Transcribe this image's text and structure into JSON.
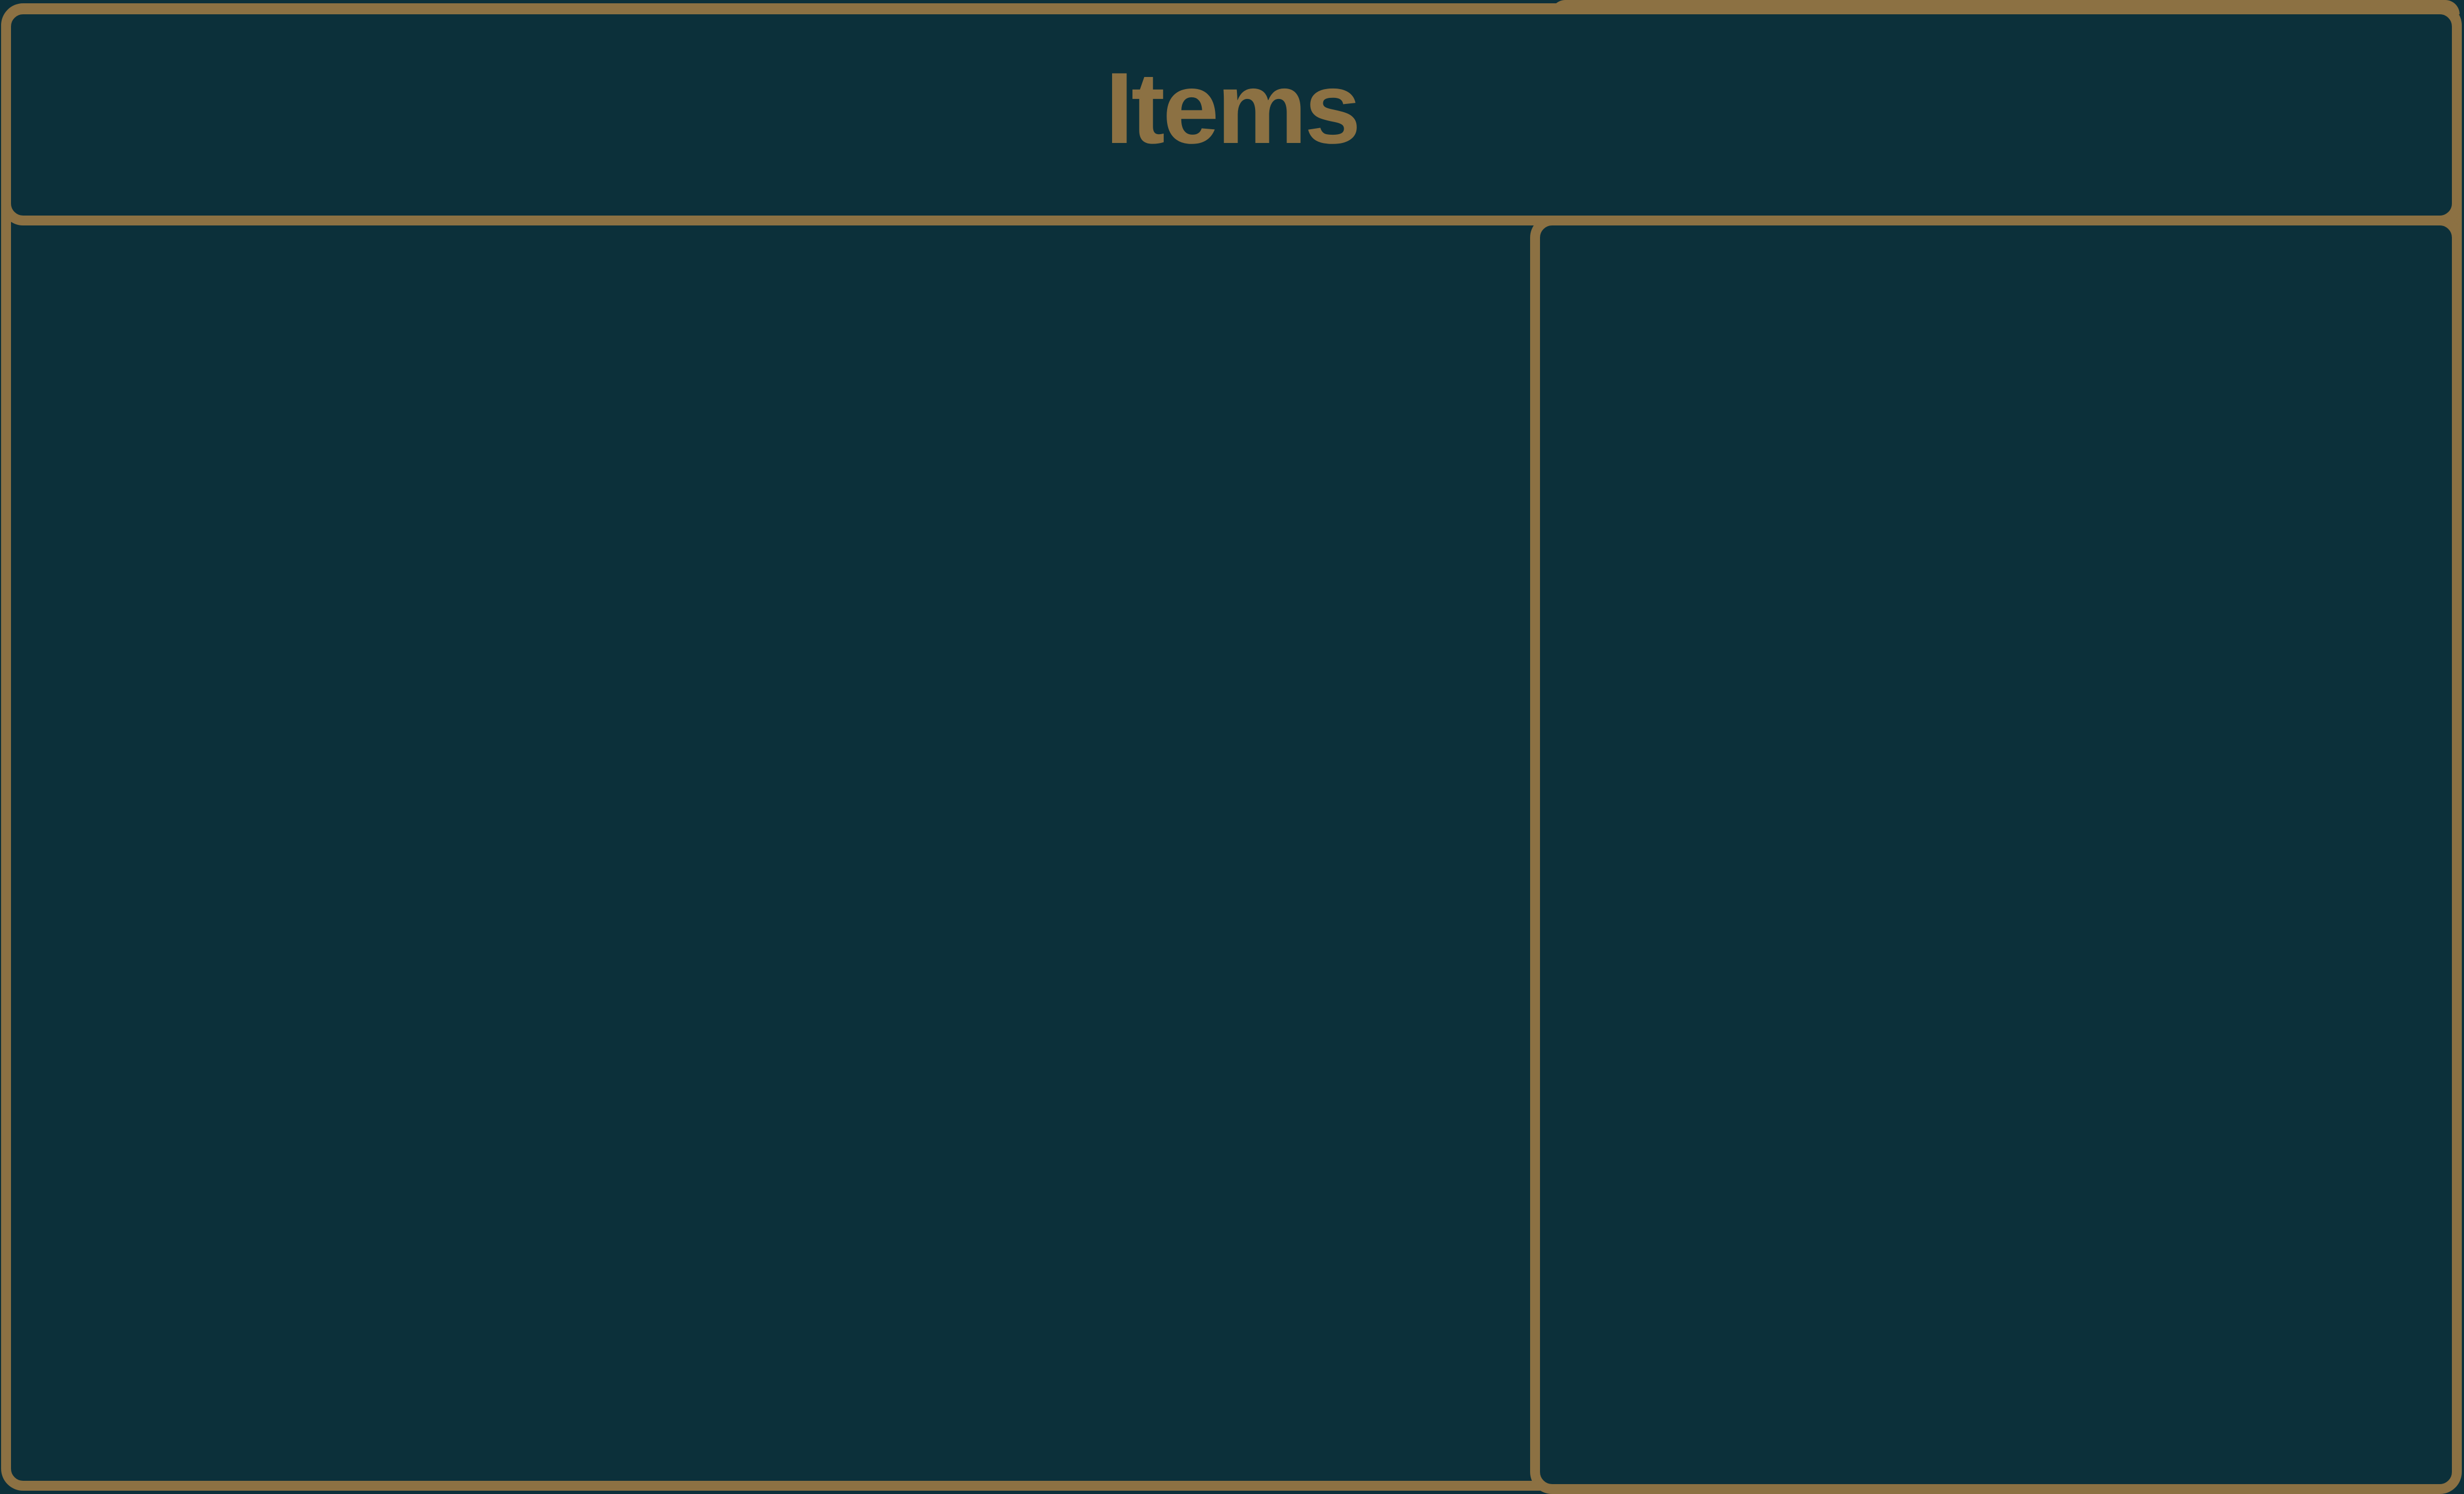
{
  "window": {
    "title": "Items"
  },
  "colors": {
    "background": "#0c303a",
    "accent": "#8c7143"
  }
}
